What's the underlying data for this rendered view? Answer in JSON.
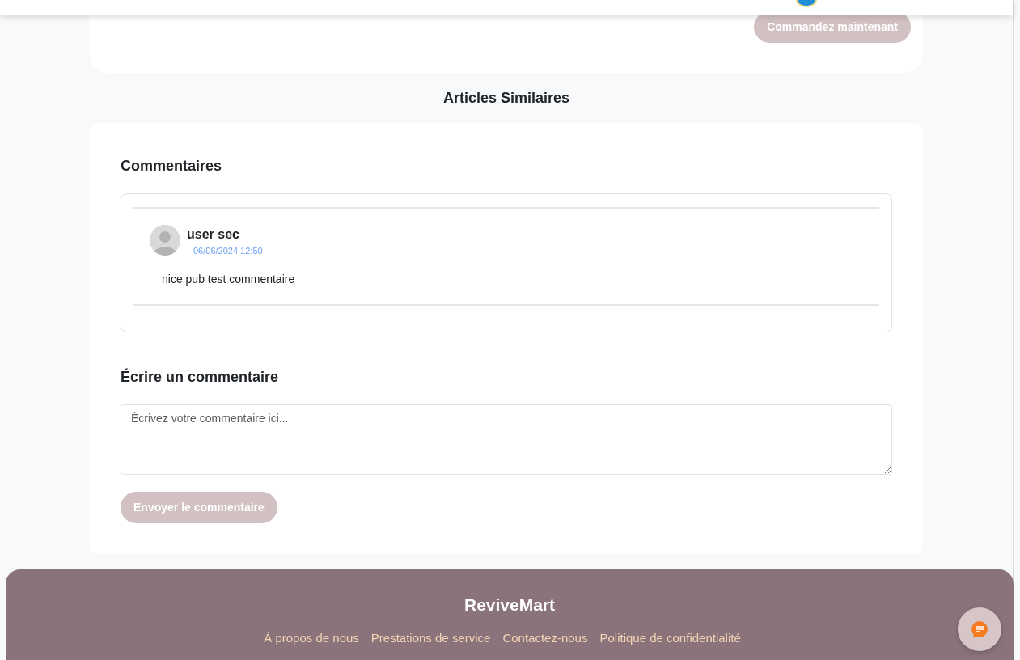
{
  "order_button": {
    "label": "Commandez maintenant",
    "disabled": true
  },
  "similar_title": "Articles Similaires",
  "comments": {
    "title": "Commentaires",
    "items": [
      {
        "author": "user sec",
        "date": "06/06/2024 12:50",
        "text": "nice pub test commentaire"
      }
    ]
  },
  "write": {
    "title": "Écrire un commentaire",
    "placeholder": "Écrivez votre commentaire ici...",
    "button": "Envoyer le commentaire",
    "button_disabled": true
  },
  "footer": {
    "brand": "ReviveMart",
    "links": [
      "À propos de nous",
      "Prestations de service",
      "Contactez-nous",
      "Politique de confidentialité"
    ]
  }
}
